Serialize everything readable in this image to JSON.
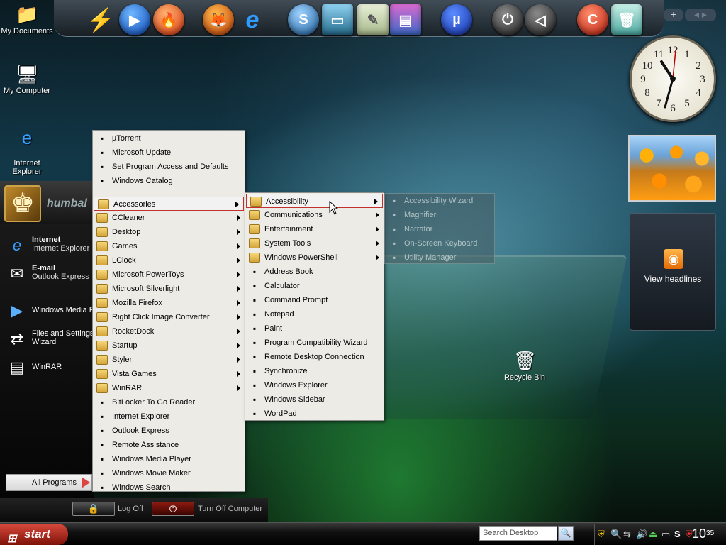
{
  "desktop": {
    "icons": [
      {
        "label": "My Documents",
        "icon": "folder-documents-icon"
      },
      {
        "label": "My Computer",
        "icon": "computer-icon"
      },
      {
        "label": "Internet\nExplorer",
        "icon": "internet-explorer-icon"
      },
      {
        "label": "Recycle Bin",
        "icon": "recycle-bin-icon"
      }
    ]
  },
  "start_menu": {
    "user_name": "humbal",
    "pinned": [
      {
        "title": "Internet",
        "subtitle": "Internet Explorer",
        "icon": "internet-explorer-icon"
      },
      {
        "title": "E-mail",
        "subtitle": "Outlook Express",
        "icon": "email-icon"
      },
      {
        "title": "Windows Media P",
        "subtitle": "",
        "icon": "media-player-icon"
      },
      {
        "title": "Files and Settings",
        "subtitle": "Wizard",
        "icon": "transfer-wizard-icon"
      },
      {
        "title": "WinRAR",
        "subtitle": "",
        "icon": "winrar-icon"
      }
    ],
    "all_programs": "All Programs",
    "log_off": "Log Off",
    "turn_off": "Turn Off Computer"
  },
  "programs_menu": {
    "top_items": [
      {
        "label": "µTorrent",
        "icon": "utorrent-icon"
      },
      {
        "label": "Microsoft Update",
        "icon": "windows-update-icon"
      },
      {
        "label": "Set Program Access and Defaults",
        "icon": "program-defaults-icon"
      },
      {
        "label": "Windows Catalog",
        "icon": "windows-catalog-icon"
      }
    ],
    "items": [
      {
        "label": "Accessories",
        "submenu": true,
        "folder": true
      },
      {
        "label": "CCleaner",
        "submenu": true,
        "folder": true
      },
      {
        "label": "Desktop",
        "submenu": true,
        "folder": true
      },
      {
        "label": "Games",
        "submenu": true,
        "folder": true
      },
      {
        "label": "LClock",
        "submenu": true,
        "folder": true
      },
      {
        "label": "Microsoft PowerToys",
        "submenu": true,
        "folder": true
      },
      {
        "label": "Microsoft Silverlight",
        "submenu": true,
        "folder": true
      },
      {
        "label": "Mozilla Firefox",
        "submenu": true,
        "folder": true
      },
      {
        "label": "Right Click Image Converter",
        "submenu": true,
        "folder": true
      },
      {
        "label": "RocketDock",
        "submenu": true,
        "folder": true
      },
      {
        "label": "Startup",
        "submenu": true,
        "folder": true
      },
      {
        "label": "Styler",
        "submenu": true,
        "folder": true
      },
      {
        "label": "Vista Games",
        "submenu": true,
        "folder": true
      },
      {
        "label": "WinRAR",
        "submenu": true,
        "folder": true
      },
      {
        "label": "BitLocker To Go Reader",
        "submenu": false,
        "folder": false,
        "icon": "bitlocker-icon"
      },
      {
        "label": "Internet Explorer",
        "submenu": false,
        "folder": false,
        "icon": "internet-explorer-icon"
      },
      {
        "label": "Outlook Express",
        "submenu": false,
        "folder": false,
        "icon": "outlook-express-icon"
      },
      {
        "label": "Remote Assistance",
        "submenu": false,
        "folder": false,
        "icon": "remote-assistance-icon"
      },
      {
        "label": "Windows Media Player",
        "submenu": false,
        "folder": false,
        "icon": "media-player-icon"
      },
      {
        "label": "Windows Movie Maker",
        "submenu": false,
        "folder": false,
        "icon": "movie-maker-icon"
      },
      {
        "label": "Windows Search",
        "submenu": false,
        "folder": false,
        "icon": "search-icon"
      }
    ]
  },
  "accessories_menu": {
    "items": [
      {
        "label": "Accessibility",
        "submenu": true,
        "folder": true
      },
      {
        "label": "Communications",
        "submenu": true,
        "folder": true
      },
      {
        "label": "Entertainment",
        "submenu": true,
        "folder": true
      },
      {
        "label": "System Tools",
        "submenu": true,
        "folder": true
      },
      {
        "label": "Windows PowerShell",
        "submenu": true,
        "folder": true
      },
      {
        "label": "Address Book",
        "submenu": false,
        "icon": "address-book-icon"
      },
      {
        "label": "Calculator",
        "submenu": false,
        "icon": "calculator-icon"
      },
      {
        "label": "Command Prompt",
        "submenu": false,
        "icon": "command-prompt-icon"
      },
      {
        "label": "Notepad",
        "submenu": false,
        "icon": "notepad-icon"
      },
      {
        "label": "Paint",
        "submenu": false,
        "icon": "paint-icon"
      },
      {
        "label": "Program Compatibility Wizard",
        "submenu": false,
        "icon": "help-icon"
      },
      {
        "label": "Remote Desktop Connection",
        "submenu": false,
        "icon": "remote-desktop-icon"
      },
      {
        "label": "Synchronize",
        "submenu": false,
        "icon": "sync-icon"
      },
      {
        "label": "Windows Explorer",
        "submenu": false,
        "icon": "explorer-folder-icon"
      },
      {
        "label": "Windows Sidebar",
        "submenu": false,
        "icon": "sidebar-icon"
      },
      {
        "label": "WordPad",
        "submenu": false,
        "icon": "wordpad-icon"
      }
    ]
  },
  "accessibility_menu": {
    "items": [
      {
        "label": "Accessibility Wizard",
        "icon": "accessibility-wizard-icon"
      },
      {
        "label": "Magnifier",
        "icon": "magnifier-icon"
      },
      {
        "label": "Narrator",
        "icon": "narrator-icon"
      },
      {
        "label": "On-Screen Keyboard",
        "icon": "keyboard-icon"
      },
      {
        "label": "Utility Manager",
        "icon": "utility-manager-icon"
      }
    ]
  },
  "taskbar": {
    "start_label": "start",
    "search_placeholder": "Search Desktop",
    "clock_hour": "10",
    "clock_min": "35"
  },
  "sidebar": {
    "feed_label": "View headlines"
  }
}
